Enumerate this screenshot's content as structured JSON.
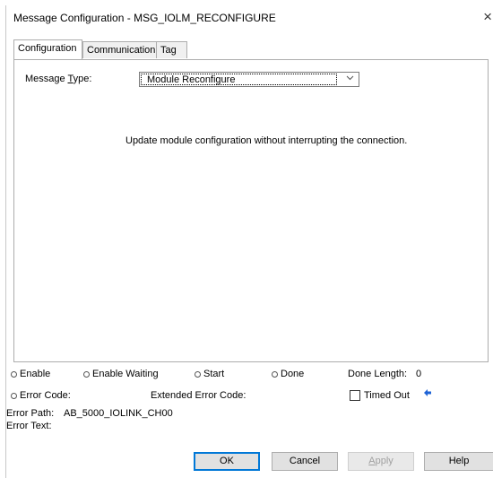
{
  "window": {
    "title": "Message Configuration - MSG_IOLM_RECONFIGURE",
    "close_glyph": "×"
  },
  "tabs": [
    {
      "label": "Configuration",
      "active": true
    },
    {
      "label": "Communication",
      "active": false
    },
    {
      "label": "Tag",
      "active": false
    }
  ],
  "config": {
    "message_type_label_pre": "Message ",
    "message_type_label_underlined": "T",
    "message_type_label_post": "ype:",
    "message_type_value": "Module Reconfigure",
    "description": "Update module configuration without interrupting the connection."
  },
  "status": {
    "enable": "Enable",
    "enable_waiting": "Enable Waiting",
    "start": "Start",
    "done": "Done",
    "done_length_label": "Done Length:",
    "done_length_value": "0",
    "error_code_label": "Error Code:",
    "extended_error_code_label": "Extended Error Code:",
    "timed_out_label": "Timed Out",
    "timed_out_checked": false,
    "error_path_label": "Error Path:",
    "error_path_value": "AB_5000_IOLINK_CH00",
    "error_text_label": "Error Text:"
  },
  "buttons": {
    "ok": "OK",
    "cancel": "Cancel",
    "apply_underlined": "A",
    "apply_rest": "pply",
    "help": "Help"
  },
  "icons": {
    "arrow": "pointer-arrow-icon",
    "arrow_color": "#1e63d6"
  }
}
